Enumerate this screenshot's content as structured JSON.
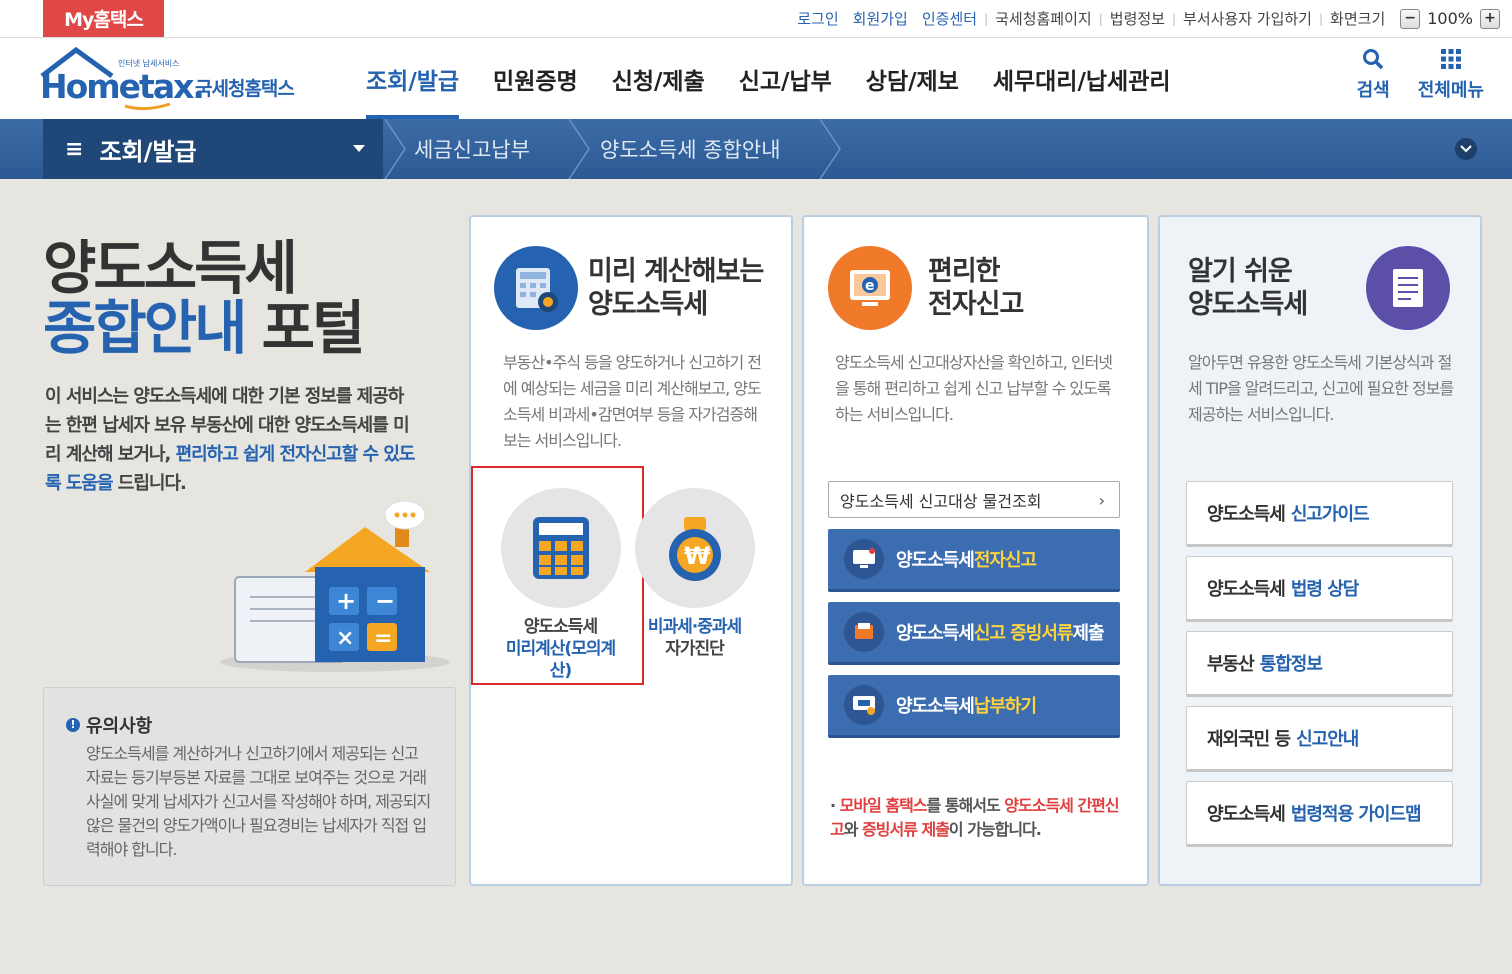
{
  "topbar": {
    "my_label": "My홈택스",
    "links": [
      {
        "label": "로그인",
        "blue": true
      },
      {
        "label": "회원가입",
        "blue": true
      },
      {
        "label": "인증센터",
        "blue": true
      },
      {
        "label": "국세청홈페이지",
        "blue": false
      },
      {
        "label": "법령정보",
        "blue": false
      },
      {
        "label": "부서사용자 가입하기",
        "blue": false
      },
      {
        "label": "화면크기",
        "blue": false
      }
    ],
    "zoom_minus": "−",
    "zoom_value": "100%",
    "zoom_plus": "+"
  },
  "header": {
    "logo_small": "인터넷 납세서비스",
    "logo_main": "Hometax.",
    "logo_kor": "국세청홈택스",
    "nav": [
      "조회/발급",
      "민원증명",
      "신청/제출",
      "신고/납부",
      "상담/제보",
      "세무대리/납세관리"
    ],
    "active_nav": 0,
    "search_label": "검색",
    "allmenu_label": "전체메뉴"
  },
  "location": {
    "menu": "조회/발급",
    "crumb1": "세금신고납부",
    "crumb2": "양도소득세 종합안내"
  },
  "intro": {
    "title_line1": "양도소득세",
    "title_line2a": "종합안내",
    "title_line2b": " 포털",
    "desc_plain1": "이 서비스는 양도소득세에 대한 기본 정보를 제공하는 한편 납세자 보유 부동산에 대한 양도소득세를 미리 계산해 보거나, ",
    "desc_hl": "편리하고 쉽게 전자신고할 수 있도록 도움을",
    "desc_plain2": " 드립니다."
  },
  "notice": {
    "title": "유의사항",
    "body": "양도소득세를 계산하거나 신고하기에서 제공되는 신고 자료는 등기부등본 자료를 그대로 보여주는 것으로 거래 사실에 맞게 납세자가 신고서를 작성해야 하며, 제공되지 않은 물건의 양도가액이나 필요경비는 납세자가 직접 입력해야 합니다."
  },
  "card1": {
    "title1": "미리 계산해보는",
    "title2": "양도소득세",
    "desc": "부동산•주식 등을 양도하거나 신고하기 전에 예상되는 세금을 미리 계산해보고, 양도소득세 비과세•감면여부 등을 자가검증해보는 서비스입니다.",
    "item1_line1": "양도소득세",
    "item1_line2": "미리계산(모의계산)",
    "item2_line1": "비과세·중과세",
    "item2_line2": "자가진단"
  },
  "card2": {
    "title1": "편리한",
    "title2": "전자신고",
    "desc": "양도소득세 신고대상자산을 확인하고, 인터넷을 통해 편리하고 쉽게 신고 납부할 수 있도록 하는 서비스입니다.",
    "search_label": "양도소득세 신고대상 물건조회",
    "btn1_a": "양도소득세 ",
    "btn1_b": "전자신고",
    "btn2_a": "양도소득세 ",
    "btn2_b": "신고 증빙서류",
    "btn2_c": " 제출",
    "btn3_a": "양도소득세 ",
    "btn3_b": "납부하기",
    "mobile_1": "모바일 홈택스",
    "mobile_2": "를 통해서도 ",
    "mobile_3": "양도소득세 간편신고",
    "mobile_4": "와 ",
    "mobile_5": "증빙서류 제출",
    "mobile_6": "이 가능합니다."
  },
  "card3": {
    "title1": "알기 쉬운",
    "title2": "양도소득세",
    "desc": "알아두면 유용한 양도소득세 기본상식과 절세 TIP을 알려드리고, 신고에 필요한 정보를 제공하는 서비스입니다.",
    "guides": [
      {
        "a": "양도소득세",
        "b": "신고가이드"
      },
      {
        "a": "양도소득세",
        "b": "법령 상담"
      },
      {
        "a": "부동산",
        "b": "통합정보"
      },
      {
        "a": "재외국민 등",
        "b": "신고안내"
      },
      {
        "a": "양도소득세",
        "b": "법령적용 가이드맵"
      }
    ]
  }
}
